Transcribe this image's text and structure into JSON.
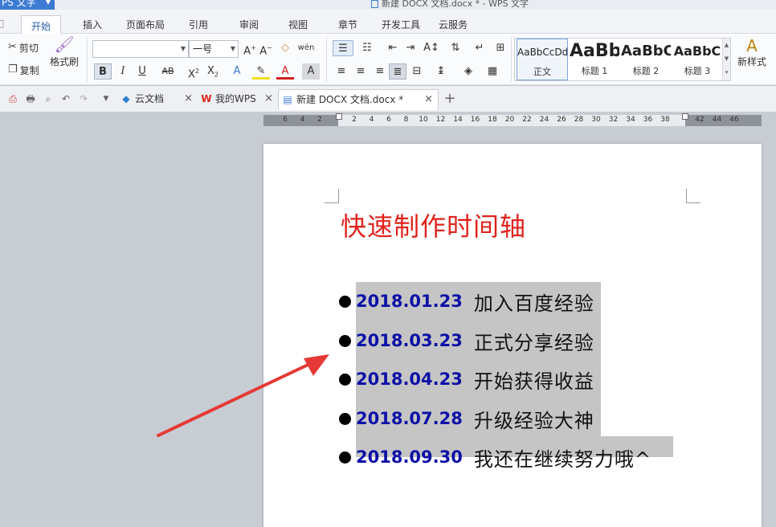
{
  "app": {
    "menu_button": "PS 文字",
    "window_title": "新建 DOCX 文档.docx * - WPS 文字"
  },
  "menu_tabs": [
    "开始",
    "插入",
    "页面布局",
    "引用",
    "审阅",
    "视图",
    "章节",
    "开发工具",
    "云服务"
  ],
  "ribbon": {
    "cut_label": "剪切",
    "copy_label": "复制",
    "format_painter_label": "格式刷",
    "font_name_value": "",
    "font_size_value": "一号",
    "new_style_label": "新样式",
    "styles": [
      {
        "sample": "AaBbCcDd",
        "name": "正文"
      },
      {
        "sample": "AaBb",
        "name": "标题 1"
      },
      {
        "sample": "AaBbC",
        "name": "标题 2"
      },
      {
        "sample": "AaBbC",
        "name": "标题 3"
      }
    ]
  },
  "doc_tabs": [
    {
      "label": "云文档",
      "icon": "cloud-doc-icon",
      "close": "×"
    },
    {
      "label": "我的WPS",
      "icon": "wps-logo-icon",
      "close": "×"
    },
    {
      "label": "新建 DOCX 文档.docx *",
      "icon": "document-icon",
      "close": "×"
    }
  ],
  "new_tab_symbol": "+",
  "ruler_ticks": [
    "6",
    "4",
    "2",
    "",
    "2",
    "4",
    "6",
    "8",
    "10",
    "12",
    "14",
    "16",
    "18",
    "20",
    "22",
    "24",
    "26",
    "28",
    "30",
    "32",
    "34",
    "36",
    "38",
    "",
    "42",
    "44",
    "46"
  ],
  "document": {
    "heading": "快速制作时间轴",
    "items": [
      {
        "date": "2018.01.23",
        "text": "加入百度经验"
      },
      {
        "date": "2018.03.23",
        "text": "正式分享经验"
      },
      {
        "date": "2018.04.23",
        "text": "开始获得收益"
      },
      {
        "date": "2018.07.28",
        "text": "升级经验大神"
      },
      {
        "date": "2018.09.30",
        "text": "我还在继续努力哦^"
      }
    ]
  },
  "colors": {
    "heading": "#e0231c",
    "date": "#0d10a6",
    "selection": "#c5c5c5",
    "arrow": "#e53935",
    "accent": "#3d7bd3"
  }
}
